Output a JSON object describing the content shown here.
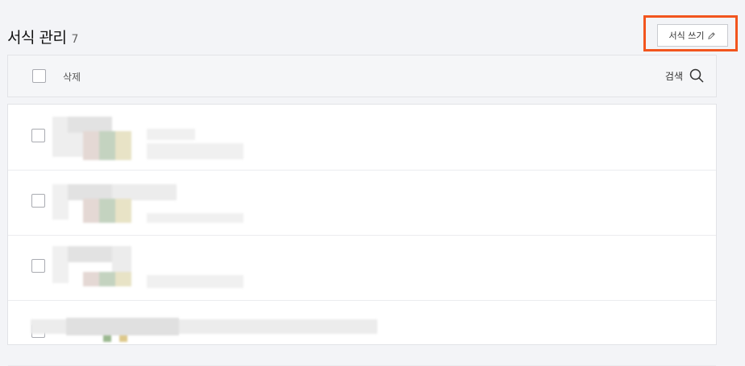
{
  "header": {
    "title": "서식 관리",
    "count": "7"
  },
  "toolbar": {
    "write_label": "서식 쓰기",
    "delete_label": "삭제",
    "search_label": "검색"
  },
  "icons": {
    "write": "pencil-icon",
    "search": "search-icon"
  },
  "colors": {
    "highlight": "#f2551e",
    "background": "#f3f4f7"
  }
}
